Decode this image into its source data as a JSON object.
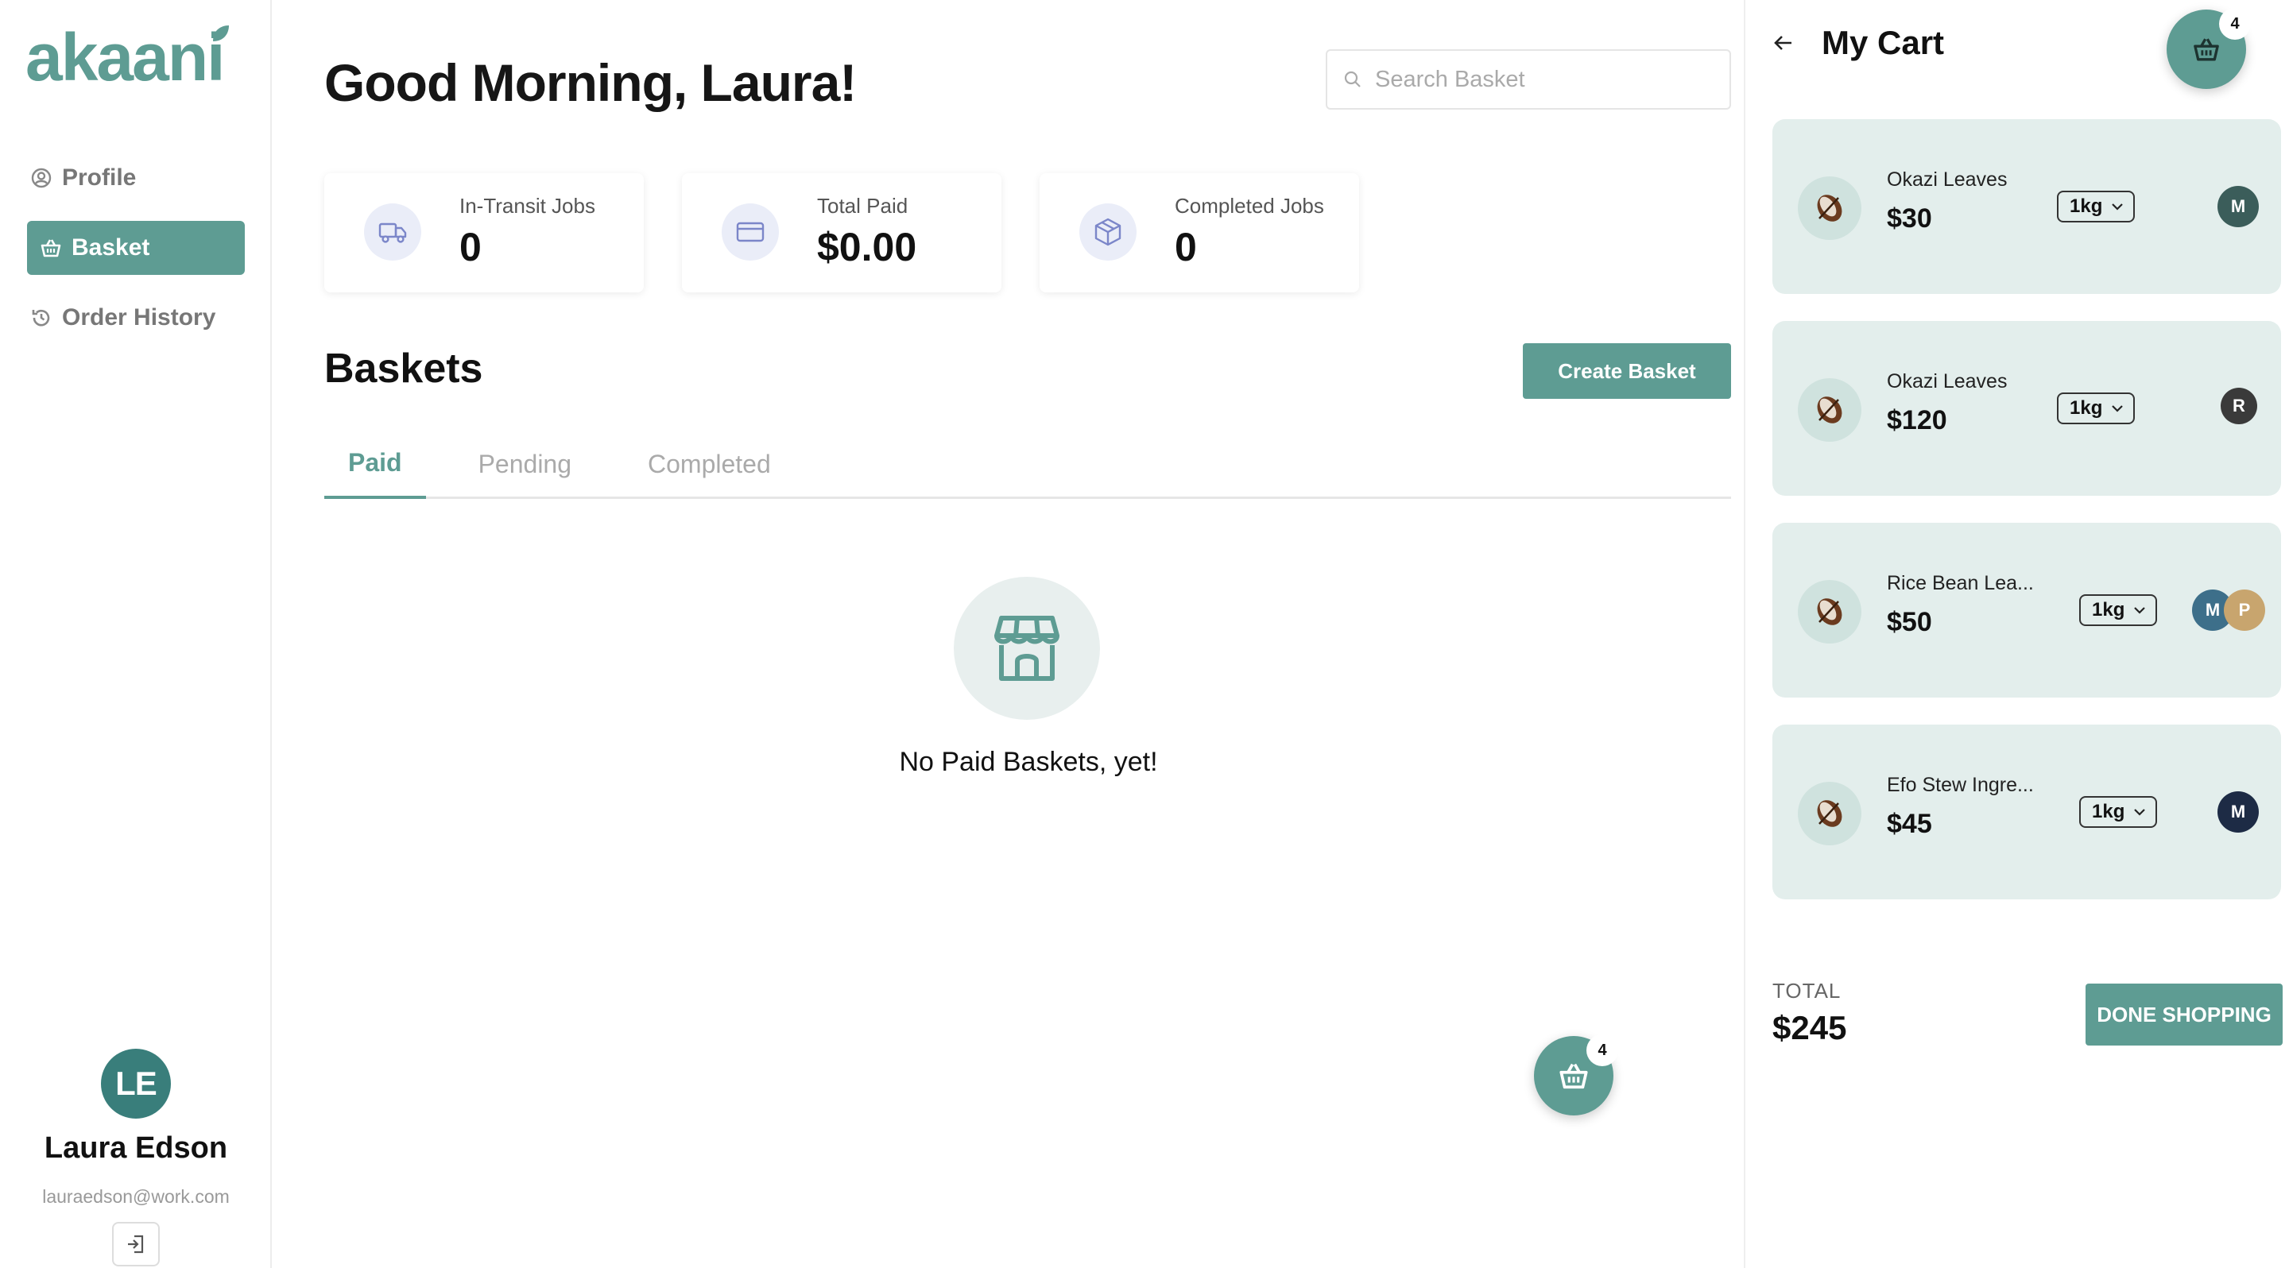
{
  "sidebar": {
    "logo": "akaani",
    "nav": [
      {
        "label": "Profile",
        "icon": "user-circle-icon"
      },
      {
        "label": "Basket",
        "icon": "basket-icon",
        "active": true
      },
      {
        "label": "Order History",
        "icon": "history-icon"
      }
    ],
    "user": {
      "initials": "LE",
      "name": "Laura Edson",
      "email": "lauraedson@work.com"
    }
  },
  "header": {
    "greeting": "Good Morning, Laura!",
    "search_placeholder": "Search Basket"
  },
  "stats": [
    {
      "label": "In-Transit Jobs",
      "value": "0",
      "icon": "truck-icon"
    },
    {
      "label": "Total Paid",
      "value": "$0.00",
      "icon": "credit-card-icon"
    },
    {
      "label": "Completed Jobs",
      "value": "0",
      "icon": "box-icon"
    }
  ],
  "baskets": {
    "title": "Baskets",
    "create_label": "Create Basket",
    "tabs": [
      "Paid",
      "Pending",
      "Completed"
    ],
    "active_tab": "Paid",
    "empty_text": "No Paid Baskets, yet!"
  },
  "fab": {
    "count": "4"
  },
  "cart": {
    "title": "My Cart",
    "count": "4",
    "items": [
      {
        "name": "Okazi Leaves",
        "price": "$30",
        "qty": "1kg",
        "badges": [
          {
            "letter": "M",
            "color": "#3b5d5a"
          }
        ]
      },
      {
        "name": "Okazi Leaves",
        "price": "$120",
        "qty": "1kg",
        "badges": [
          {
            "letter": "R",
            "color": "#3a3a3a"
          }
        ]
      },
      {
        "name": "Rice Bean Lea...",
        "price": "$50",
        "qty": "1kg",
        "badges": [
          {
            "letter": "M",
            "color": "#3d6f8a"
          },
          {
            "letter": "P",
            "color": "#c8a56e"
          }
        ]
      },
      {
        "name": "Efo Stew Ingre...",
        "price": "$45",
        "qty": "1kg",
        "badges": [
          {
            "letter": "M",
            "color": "#1d2b45"
          }
        ]
      }
    ],
    "total_label": "TOTAL",
    "total_value": "$245",
    "done_label": "DONE SHOPPING"
  },
  "colors": {
    "accent": "#5e9c93",
    "avatar": "#397e7b",
    "card_bg": "#e3eeec"
  }
}
